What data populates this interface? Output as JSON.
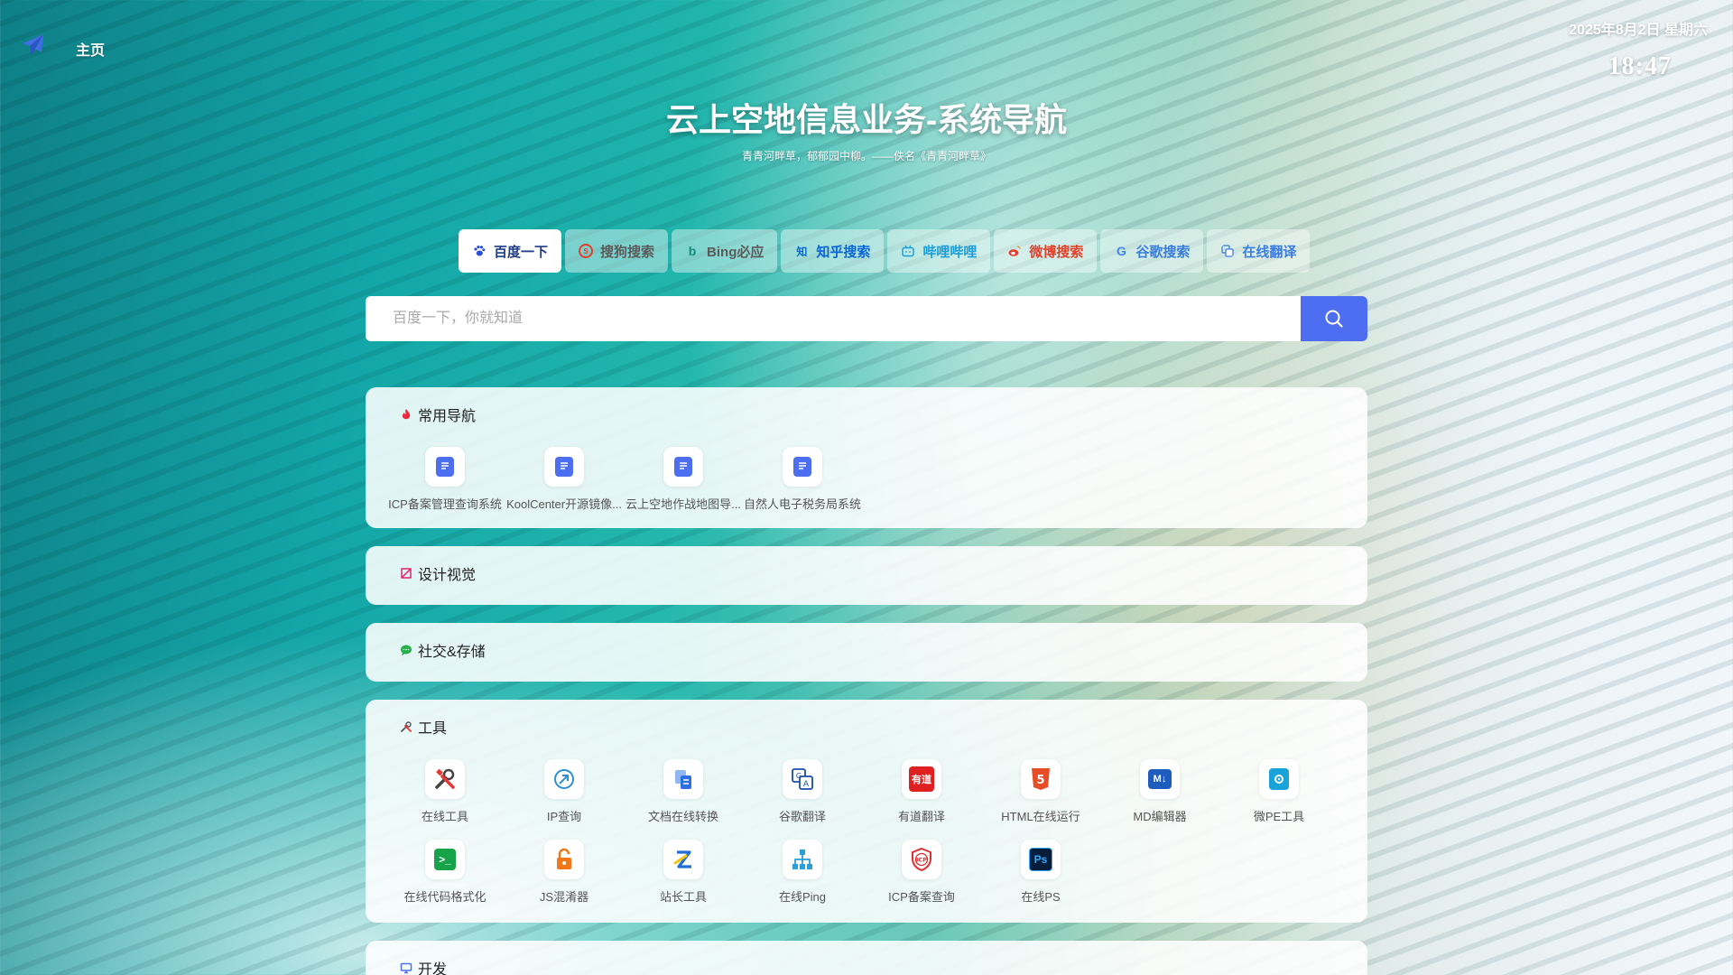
{
  "nav": {
    "home_label": "主页"
  },
  "clock": {
    "date": "2025年8月2日 星期六",
    "time": "18:47"
  },
  "hero": {
    "title": "云上空地信息业务-系统导航",
    "quote": "青青河畔草，郁郁园中柳。——佚名《青青河畔草》"
  },
  "engines": [
    {
      "label": "百度一下",
      "icon": "paw-icon",
      "color": "#1f3d86"
    },
    {
      "label": "搜狗搜索",
      "icon": "sogou-icon",
      "color": "#5a5a5a"
    },
    {
      "label": "Bing必应",
      "icon": "bing-icon",
      "color": "#5a5a5a"
    },
    {
      "label": "知乎搜索",
      "icon": "zhihu-icon",
      "color": "#0a66d6"
    },
    {
      "label": "哔哩哔哩",
      "icon": "bilibili-icon",
      "color": "#1e9ed8"
    },
    {
      "label": "微博搜索",
      "icon": "weibo-icon",
      "color": "#e3402a"
    },
    {
      "label": "谷歌搜索",
      "icon": "google-icon",
      "color": "#3b7ddd"
    },
    {
      "label": "在线翻译",
      "icon": "translate-icon",
      "color": "#3b7ddd"
    }
  ],
  "search": {
    "placeholder": "百度一下，你就知道"
  },
  "sections": [
    {
      "title": "常用导航",
      "icon": "fire-icon",
      "items": [
        {
          "label": "ICP备案管理查询系统",
          "icon": "doc-icon"
        },
        {
          "label": "KoolCenter开源镜像...",
          "icon": "doc-icon"
        },
        {
          "label": "云上空地作战地图导...",
          "icon": "doc-icon"
        },
        {
          "label": "自然人电子税务局系统",
          "icon": "doc-icon"
        }
      ]
    },
    {
      "title": "设计视觉",
      "icon": "design-icon",
      "items": []
    },
    {
      "title": "社交&存储",
      "icon": "chat-icon",
      "items": []
    },
    {
      "title": "工具",
      "icon": "tools-icon",
      "items": [
        {
          "label": "在线工具",
          "icon": "wrench-icon"
        },
        {
          "label": "IP查询",
          "icon": "ip-icon"
        },
        {
          "label": "文档在线转换",
          "icon": "convert-icon"
        },
        {
          "label": "谷歌翻译",
          "icon": "google-translate-icon"
        },
        {
          "label": "有道翻译",
          "icon": "youdao-icon"
        },
        {
          "label": "HTML在线运行",
          "icon": "html5-icon"
        },
        {
          "label": "MD编辑器",
          "icon": "markdown-icon"
        },
        {
          "label": "微PE工具",
          "icon": "wepe-icon"
        },
        {
          "label": "在线代码格式化",
          "icon": "terminal-icon"
        },
        {
          "label": "JS混淆器",
          "icon": "lock-icon"
        },
        {
          "label": "站长工具",
          "icon": "chinaz-icon"
        },
        {
          "label": "在线Ping",
          "icon": "network-icon"
        },
        {
          "label": "ICP备案查询",
          "icon": "icp-shield-icon"
        },
        {
          "label": "在线PS",
          "icon": "photoshop-icon"
        }
      ]
    },
    {
      "title": "开发",
      "icon": "monitor-icon",
      "items": []
    }
  ]
}
